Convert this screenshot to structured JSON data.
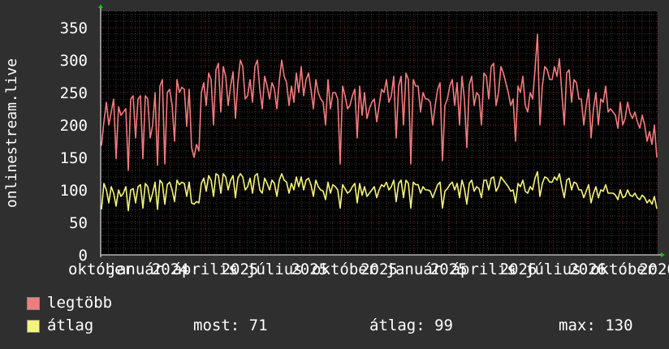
{
  "chart_data": {
    "type": "line",
    "title": "",
    "xlabel": "",
    "ylabel": "onlinestream.live",
    "ylim": [
      0,
      375
    ],
    "yticks": [
      0,
      50,
      100,
      150,
      200,
      250,
      300,
      350
    ],
    "x_tick_labels": [
      "október",
      "január",
      "2024",
      "április",
      "2025",
      "július",
      "2025",
      "október",
      "2025",
      "január",
      "2025",
      "április",
      "2026",
      "július",
      "2026",
      "október",
      "2026"
    ],
    "grid": true,
    "colors": {
      "background": "#2f2f2f",
      "plot": "#000000",
      "grid_minor": "#3a3a3a",
      "grid_major": "#7a2a2a",
      "axis": "#ffffff",
      "max_line": "#f37b7e",
      "avg_line": "#f4f47b",
      "arrow": "#00cc00"
    },
    "series": [
      {
        "name": "legtöbb",
        "values": [
          168,
          205,
          235,
          200,
          220,
          240,
          148,
          228,
          215,
          220,
          225,
          130,
          240,
          245,
          180,
          240,
          245,
          148,
          245,
          240,
          180,
          200,
          250,
          138,
          260,
          270,
          140,
          250,
          255,
          230,
          175,
          270,
          250,
          258,
          255,
          198,
          255,
          165,
          150,
          170,
          160,
          250,
          265,
          230,
          280,
          270,
          200,
          285,
          295,
          220,
          290,
          275,
          230,
          260,
          282,
          210,
          265,
          300,
          290,
          240,
          245,
          270,
          235,
          290,
          300,
          255,
          225,
          275,
          260,
          240,
          265,
          255,
          225,
          268,
          300,
          275,
          265,
          230,
          260,
          235,
          280,
          250,
          290,
          245,
          270,
          280,
          255,
          225,
          270,
          250,
          240,
          235,
          200,
          270,
          225,
          250,
          250,
          240,
          140,
          260,
          245,
          225,
          230,
          245,
          255,
          180,
          260,
          215,
          250,
          210,
          225,
          235,
          240,
          205,
          230,
          255,
          250,
          270,
          235,
          245,
          275,
          180,
          260,
          275,
          200,
          280,
          270,
          140,
          270,
          260,
          260,
          220,
          250,
          240,
          240,
          235,
          200,
          230,
          255,
          265,
          145,
          230,
          240,
          260,
          270,
          230,
          265,
          200,
          275,
          240,
          165,
          262,
          275,
          230,
          250,
          245,
          200,
          280,
          275,
          240,
          290,
          295,
          230,
          250,
          290,
          280,
          265,
          250,
          230,
          240,
          175,
          260,
          250,
          275,
          230,
          220,
          250,
          240,
          285,
          340,
          200,
          260,
          290,
          285,
          270,
          270,
          290,
          275,
          302,
          250,
          200,
          280,
          285,
          235,
          270,
          265,
          240,
          240,
          200,
          230,
          255,
          180,
          225,
          250,
          200,
          240,
          235,
          260,
          220,
          225,
          220,
          215,
          195,
          235,
          200,
          210,
          235,
          218,
          210,
          220,
          205,
          195,
          215,
          200,
          175,
          190,
          170,
          200,
          150
        ]
      },
      {
        "name": "átlag",
        "values": [
          70,
          110,
          100,
          80,
          105,
          95,
          75,
          100,
          90,
          95,
          105,
          68,
          100,
          102,
          80,
          105,
          108,
          72,
          110,
          105,
          82,
          95,
          112,
          70,
          115,
          110,
          78,
          108,
          112,
          100,
          82,
          115,
          108,
          112,
          110,
          90,
          112,
          80,
          78,
          82,
          80,
          110,
          118,
          98,
          122,
          115,
          90,
          125,
          122,
          95,
          125,
          120,
          100,
          115,
          122,
          88,
          118,
          125,
          120,
          100,
          105,
          118,
          95,
          122,
          125,
          100,
          95,
          118,
          110,
          100,
          115,
          110,
          90,
          115,
          125,
          115,
          112,
          95,
          110,
          100,
          120,
          105,
          120,
          100,
          115,
          118,
          108,
          90,
          115,
          105,
          100,
          98,
          85,
          112,
          95,
          108,
          105,
          100,
          72,
          108,
          102,
          95,
          98,
          105,
          110,
          80,
          110,
          92,
          105,
          90,
          95,
          100,
          105,
          88,
          100,
          108,
          105,
          112,
          100,
          105,
          115,
          82,
          110,
          115,
          88,
          115,
          110,
          72,
          112,
          108,
          108,
          95,
          105,
          100,
          100,
          98,
          88,
          98,
          108,
          112,
          72,
          98,
          102,
          108,
          112,
          100,
          110,
          88,
          115,
          102,
          78,
          110,
          115,
          98,
          105,
          102,
          88,
          115,
          115,
          100,
          118,
          120,
          98,
          105,
          120,
          115,
          110,
          105,
          98,
          100,
          80,
          110,
          105,
          115,
          98,
          95,
          105,
          100,
          118,
          128,
          90,
          110,
          120,
          118,
          112,
          112,
          120,
          115,
          125,
          105,
          88,
          115,
          118,
          100,
          112,
          110,
          100,
          100,
          88,
          98,
          108,
          80,
          95,
          105,
          88,
          100,
          98,
          108,
          95,
          95,
          95,
          92,
          85,
          100,
          88,
          90,
          100,
          92,
          90,
          95,
          88,
          85,
          92,
          88,
          80,
          85,
          78,
          90,
          71
        ]
      }
    ]
  },
  "legend": {
    "max_label": "legtöbb",
    "avg_label": "átlag"
  },
  "stats": {
    "current": "most: 71",
    "average": "átlag: 99",
    "maximum": "max: 130"
  }
}
